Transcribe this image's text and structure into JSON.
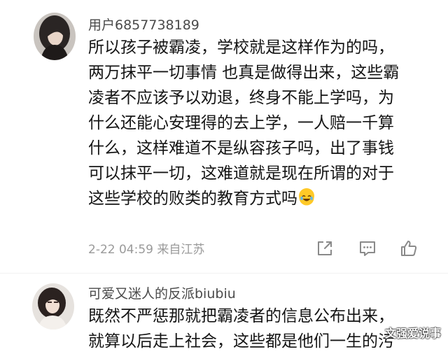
{
  "comments": [
    {
      "username": "用户6857738189",
      "avatar_icon": "user-avatar-photo",
      "lines": [
        "所以孩子被霸凌，学校就是这样作为的吗，",
        "两万抹平一切事情 也真是做得出来，这些霸",
        "凌者不应该予以劝退，终身不能上学吗，为",
        "什么还能心安理得的去上学，一人赔一千算",
        "什么，这样难道不是纵容孩子吗，出了事钱",
        "可以抹平一切，这难道就是现在所谓的对于",
        "这些学校的败类的教育方式吗"
      ],
      "emoji_icon": "laughing-crying-emoji",
      "timestamp": "2-22 04:59",
      "location": "来自江苏",
      "actions": [
        "share-icon",
        "comment-icon",
        "like-icon"
      ]
    },
    {
      "username": "可爱又迷人的反派biubiu",
      "avatar_icon": "user-avatar-photo",
      "lines": [
        "既然不严惩那就把霸凌者的信息公布出来，",
        "就算以后走上社会，这些都是他们一生的污"
      ]
    }
  ],
  "watermark": "文强爱说事",
  "colors": {
    "username": "#4a4a4a",
    "body_text": "#141414",
    "meta_text": "#9a9a9a",
    "icon_stroke": "#8a8a8a"
  }
}
